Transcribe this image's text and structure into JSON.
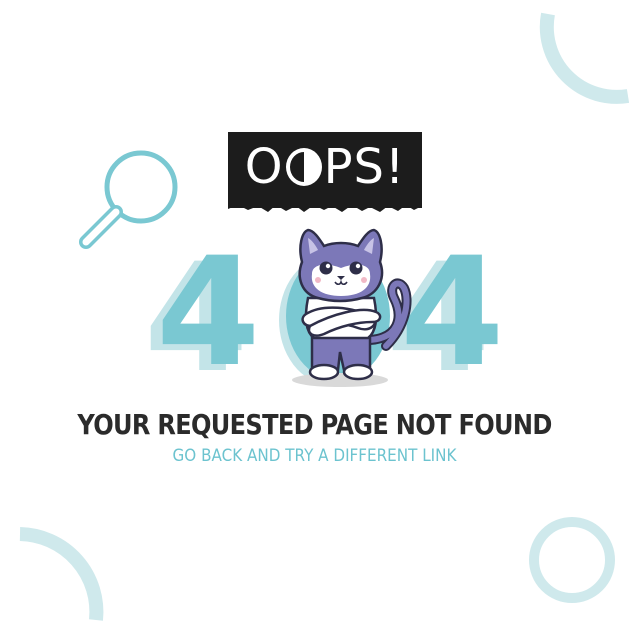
{
  "banner": {
    "first_letter": "O",
    "rest": "PS!"
  },
  "error_code": {
    "first_digit": "4",
    "last_digit": "4"
  },
  "headline": "YOUR REQUESTED PAGE NOT FOUND",
  "subline": "GO BACK AND TRY A DIFFERENT LINK",
  "colors": {
    "accent": "#7ac8d2",
    "accent_light": "#c3e4e8",
    "ring": "#cfe9ec",
    "banner_bg": "#1c1c1c",
    "headline_text": "#2b2b2b",
    "cat_body": "#7c78b8"
  },
  "icons": [
    "magnifier-icon",
    "cat-illustration"
  ]
}
